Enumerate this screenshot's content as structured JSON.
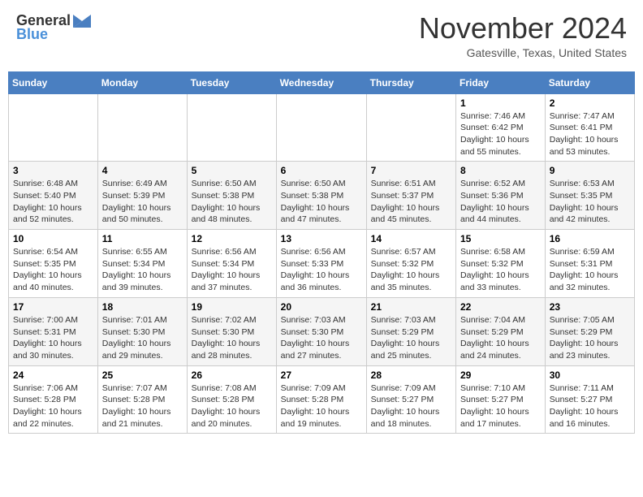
{
  "header": {
    "logo_general": "General",
    "logo_blue": "Blue",
    "month_title": "November 2024",
    "location": "Gatesville, Texas, United States"
  },
  "calendar": {
    "weekdays": [
      "Sunday",
      "Monday",
      "Tuesday",
      "Wednesday",
      "Thursday",
      "Friday",
      "Saturday"
    ],
    "weeks": [
      [
        {
          "day": "",
          "info": ""
        },
        {
          "day": "",
          "info": ""
        },
        {
          "day": "",
          "info": ""
        },
        {
          "day": "",
          "info": ""
        },
        {
          "day": "",
          "info": ""
        },
        {
          "day": "1",
          "info": "Sunrise: 7:46 AM\nSunset: 6:42 PM\nDaylight: 10 hours and 55 minutes."
        },
        {
          "day": "2",
          "info": "Sunrise: 7:47 AM\nSunset: 6:41 PM\nDaylight: 10 hours and 53 minutes."
        }
      ],
      [
        {
          "day": "3",
          "info": "Sunrise: 6:48 AM\nSunset: 5:40 PM\nDaylight: 10 hours and 52 minutes."
        },
        {
          "day": "4",
          "info": "Sunrise: 6:49 AM\nSunset: 5:39 PM\nDaylight: 10 hours and 50 minutes."
        },
        {
          "day": "5",
          "info": "Sunrise: 6:50 AM\nSunset: 5:38 PM\nDaylight: 10 hours and 48 minutes."
        },
        {
          "day": "6",
          "info": "Sunrise: 6:50 AM\nSunset: 5:38 PM\nDaylight: 10 hours and 47 minutes."
        },
        {
          "day": "7",
          "info": "Sunrise: 6:51 AM\nSunset: 5:37 PM\nDaylight: 10 hours and 45 minutes."
        },
        {
          "day": "8",
          "info": "Sunrise: 6:52 AM\nSunset: 5:36 PM\nDaylight: 10 hours and 44 minutes."
        },
        {
          "day": "9",
          "info": "Sunrise: 6:53 AM\nSunset: 5:35 PM\nDaylight: 10 hours and 42 minutes."
        }
      ],
      [
        {
          "day": "10",
          "info": "Sunrise: 6:54 AM\nSunset: 5:35 PM\nDaylight: 10 hours and 40 minutes."
        },
        {
          "day": "11",
          "info": "Sunrise: 6:55 AM\nSunset: 5:34 PM\nDaylight: 10 hours and 39 minutes."
        },
        {
          "day": "12",
          "info": "Sunrise: 6:56 AM\nSunset: 5:34 PM\nDaylight: 10 hours and 37 minutes."
        },
        {
          "day": "13",
          "info": "Sunrise: 6:56 AM\nSunset: 5:33 PM\nDaylight: 10 hours and 36 minutes."
        },
        {
          "day": "14",
          "info": "Sunrise: 6:57 AM\nSunset: 5:32 PM\nDaylight: 10 hours and 35 minutes."
        },
        {
          "day": "15",
          "info": "Sunrise: 6:58 AM\nSunset: 5:32 PM\nDaylight: 10 hours and 33 minutes."
        },
        {
          "day": "16",
          "info": "Sunrise: 6:59 AM\nSunset: 5:31 PM\nDaylight: 10 hours and 32 minutes."
        }
      ],
      [
        {
          "day": "17",
          "info": "Sunrise: 7:00 AM\nSunset: 5:31 PM\nDaylight: 10 hours and 30 minutes."
        },
        {
          "day": "18",
          "info": "Sunrise: 7:01 AM\nSunset: 5:30 PM\nDaylight: 10 hours and 29 minutes."
        },
        {
          "day": "19",
          "info": "Sunrise: 7:02 AM\nSunset: 5:30 PM\nDaylight: 10 hours and 28 minutes."
        },
        {
          "day": "20",
          "info": "Sunrise: 7:03 AM\nSunset: 5:30 PM\nDaylight: 10 hours and 27 minutes."
        },
        {
          "day": "21",
          "info": "Sunrise: 7:03 AM\nSunset: 5:29 PM\nDaylight: 10 hours and 25 minutes."
        },
        {
          "day": "22",
          "info": "Sunrise: 7:04 AM\nSunset: 5:29 PM\nDaylight: 10 hours and 24 minutes."
        },
        {
          "day": "23",
          "info": "Sunrise: 7:05 AM\nSunset: 5:29 PM\nDaylight: 10 hours and 23 minutes."
        }
      ],
      [
        {
          "day": "24",
          "info": "Sunrise: 7:06 AM\nSunset: 5:28 PM\nDaylight: 10 hours and 22 minutes."
        },
        {
          "day": "25",
          "info": "Sunrise: 7:07 AM\nSunset: 5:28 PM\nDaylight: 10 hours and 21 minutes."
        },
        {
          "day": "26",
          "info": "Sunrise: 7:08 AM\nSunset: 5:28 PM\nDaylight: 10 hours and 20 minutes."
        },
        {
          "day": "27",
          "info": "Sunrise: 7:09 AM\nSunset: 5:28 PM\nDaylight: 10 hours and 19 minutes."
        },
        {
          "day": "28",
          "info": "Sunrise: 7:09 AM\nSunset: 5:27 PM\nDaylight: 10 hours and 18 minutes."
        },
        {
          "day": "29",
          "info": "Sunrise: 7:10 AM\nSunset: 5:27 PM\nDaylight: 10 hours and 17 minutes."
        },
        {
          "day": "30",
          "info": "Sunrise: 7:11 AM\nSunset: 5:27 PM\nDaylight: 10 hours and 16 minutes."
        }
      ]
    ]
  }
}
